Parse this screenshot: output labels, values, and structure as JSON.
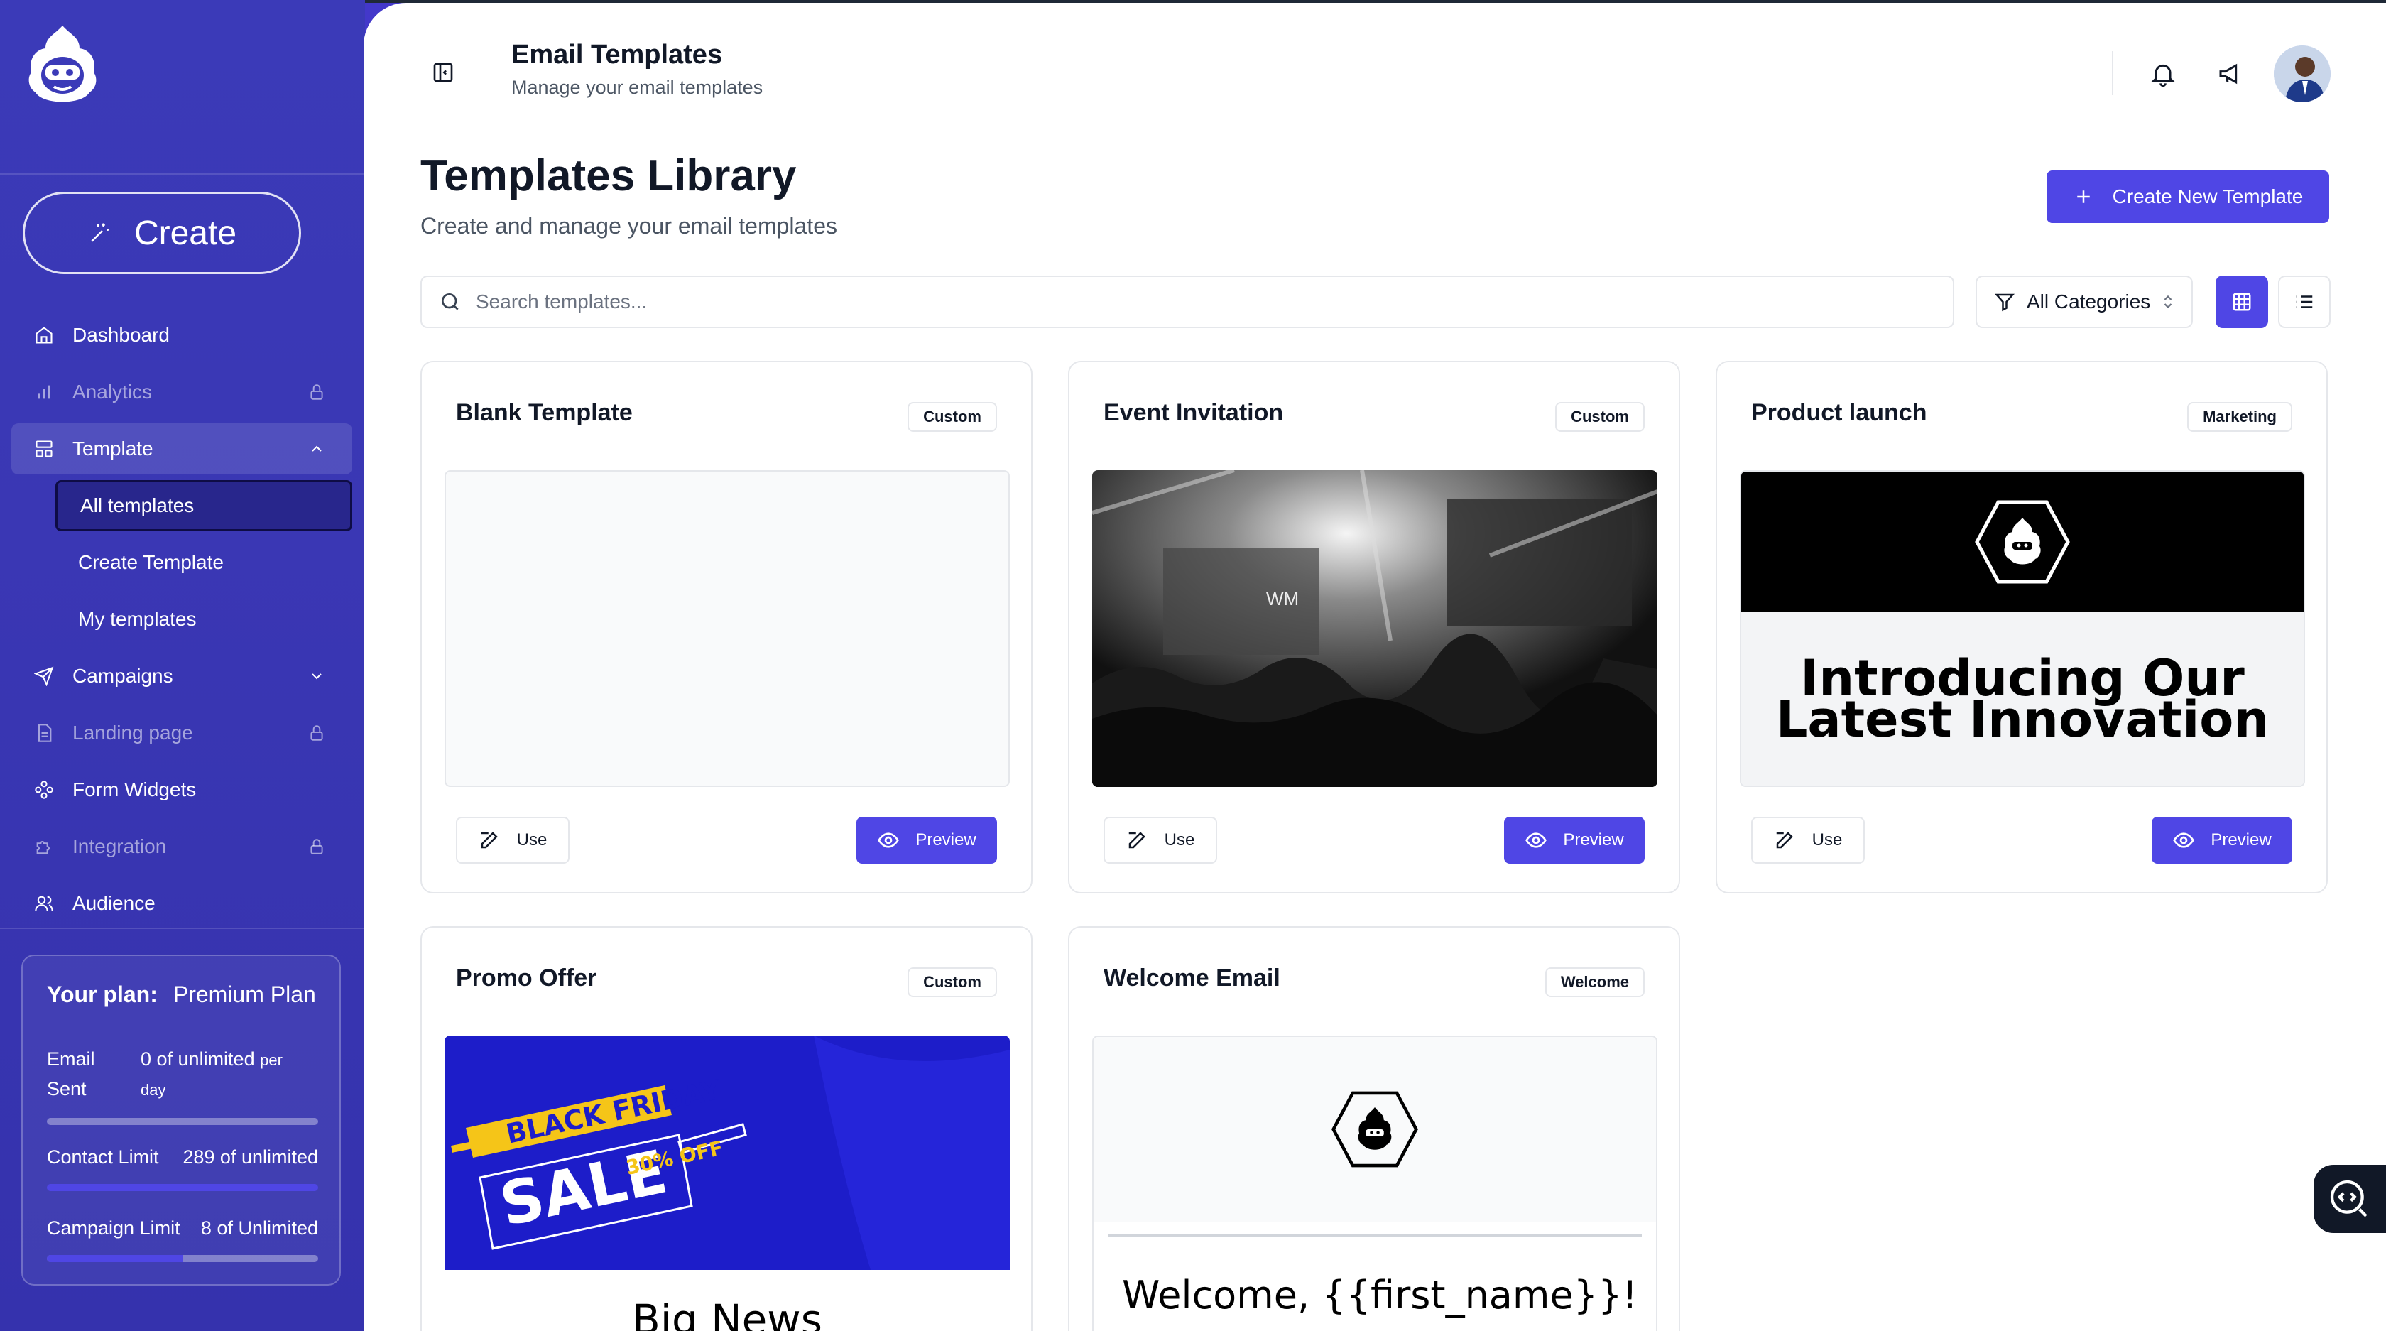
{
  "sidebar": {
    "create_label": "Create",
    "nav": [
      {
        "label": "Dashboard",
        "icon": "home-icon"
      },
      {
        "label": "Analytics",
        "icon": "bar-chart-icon",
        "locked": true
      },
      {
        "label": "Template",
        "icon": "layout-icon",
        "expanded": true
      }
    ],
    "template_sub": [
      "All templates",
      "Create Template",
      "My templates"
    ],
    "nav2": [
      {
        "label": "Campaigns",
        "icon": "send-icon"
      },
      {
        "label": "Landing page",
        "icon": "file-icon",
        "locked": true
      },
      {
        "label": "Form Widgets",
        "icon": "widgets-icon"
      },
      {
        "label": "Integration",
        "icon": "puzzle-icon",
        "locked": true
      },
      {
        "label": "Audience",
        "icon": "users-icon"
      }
    ],
    "plan": {
      "label": "Your plan:",
      "value": "Premium Plan",
      "email_label_1": "Email",
      "email_label_2": "Sent",
      "email_value": "0 of unlimited",
      "email_unit_1": "per",
      "email_unit_2": "day",
      "email_progress": 0,
      "contact_label": "Contact Limit",
      "contact_value": "289 of unlimited",
      "contact_progress": 1,
      "campaign_label": "Campaign Limit",
      "campaign_value": "8 of Unlimited",
      "campaign_progress": 0.5
    }
  },
  "header": {
    "title": "Email Templates",
    "subtitle": "Manage your email templates"
  },
  "library": {
    "title": "Templates Library",
    "subtitle": "Create and manage your email templates",
    "new_button": "Create New Template",
    "search_placeholder": "Search templates...",
    "category_filter": "All Categories"
  },
  "templates": [
    {
      "name": "Blank Template",
      "badge": "Custom",
      "use": "Use",
      "preview": "Preview"
    },
    {
      "name": "Event Invitation",
      "badge": "Custom",
      "use": "Use",
      "preview": "Preview",
      "thumb_text": "WM"
    },
    {
      "name": "Product launch",
      "badge": "Marketing",
      "use": "Use",
      "preview": "Preview",
      "thumb_line1": "Introducing Our",
      "thumb_line2": "Latest Innovation"
    },
    {
      "name": "Promo Offer",
      "badge": "Custom",
      "thumb_top": "BLACK FRIDAY",
      "thumb_sale": "SALE",
      "thumb_off": "30% OFF",
      "thumb_bottom": "Big News"
    },
    {
      "name": "Welcome Email",
      "badge": "Welcome",
      "thumb_bottom": "Welcome, {{first_name}}!"
    }
  ],
  "colors": {
    "accent": "#4f46e5",
    "sidebar": "#3a37b4"
  }
}
